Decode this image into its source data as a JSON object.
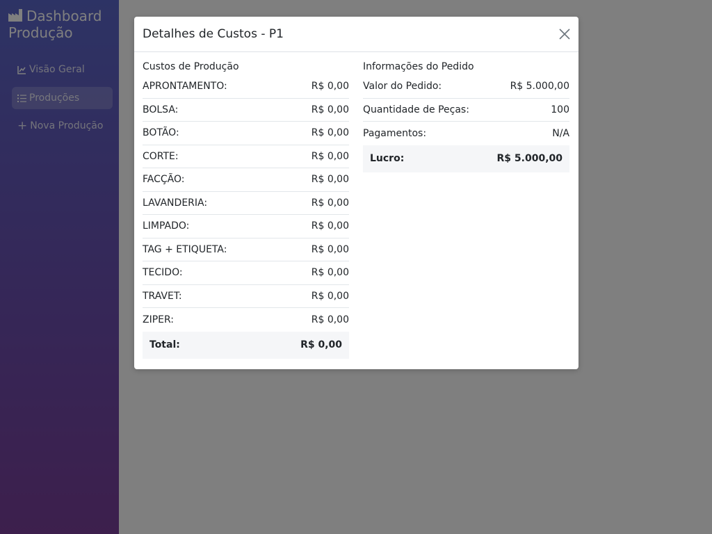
{
  "sidebar": {
    "brand_line1": "Dashboard",
    "brand_line2": "Produção",
    "items": [
      {
        "label": "Visão Geral",
        "icon": "chart-line-icon"
      },
      {
        "label": "Produções",
        "icon": "list-icon"
      },
      {
        "label": "Nova Produção",
        "icon": "plus-icon"
      }
    ]
  },
  "modal": {
    "title": "Detalhes de Custos - P1",
    "costs": {
      "title": "Custos de Produção",
      "rows": [
        {
          "label": "APRONTAMENTO:",
          "value": "R$ 0,00"
        },
        {
          "label": "BOLSA:",
          "value": "R$ 0,00"
        },
        {
          "label": "BOTÃO:",
          "value": "R$ 0,00"
        },
        {
          "label": "CORTE:",
          "value": "R$ 0,00"
        },
        {
          "label": "FACÇÃO:",
          "value": "R$ 0,00"
        },
        {
          "label": "LAVANDERIA:",
          "value": "R$ 0,00"
        },
        {
          "label": "LIMPADO:",
          "value": "R$ 0,00"
        },
        {
          "label": "TAG + ETIQUETA:",
          "value": "R$ 0,00"
        },
        {
          "label": "TECIDO:",
          "value": "R$ 0,00"
        },
        {
          "label": "TRAVET:",
          "value": "R$ 0,00"
        },
        {
          "label": "ZIPER:",
          "value": "R$ 0,00"
        }
      ],
      "total_label": "Total:",
      "total_value": "R$ 0,00"
    },
    "order": {
      "title": "Informações do Pedido",
      "rows": [
        {
          "label": "Valor do Pedido:",
          "value": "R$ 5.000,00"
        },
        {
          "label": "Quantidade de Peças:",
          "value": "100"
        },
        {
          "label": "Pagamentos:",
          "value": "N/A"
        }
      ],
      "profit_label": "Lucro:",
      "profit_value": "R$ 5.000,00"
    }
  }
}
